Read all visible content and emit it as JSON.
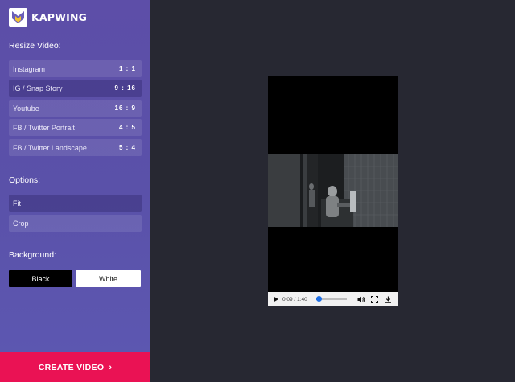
{
  "brand": {
    "name": "KAPWING"
  },
  "resize": {
    "title": "Resize Video:",
    "items": [
      {
        "label": "Instagram",
        "ratio": "1 : 1"
      },
      {
        "label": "IG / Snap Story",
        "ratio": "9 : 16",
        "selected": true
      },
      {
        "label": "Youtube",
        "ratio": "16 : 9"
      },
      {
        "label": "FB / Twitter Portrait",
        "ratio": "4 : 5"
      },
      {
        "label": "FB / Twitter Landscape",
        "ratio": "5 : 4"
      }
    ]
  },
  "options": {
    "title": "Options:",
    "items": [
      {
        "label": "Fit",
        "selected": true
      },
      {
        "label": "Crop"
      }
    ]
  },
  "background": {
    "title": "Background:",
    "black_label": "Black",
    "white_label": "White"
  },
  "create": {
    "label": "CREATE VIDEO"
  },
  "player": {
    "time": "0:09 / 1:40",
    "progress": 0.09
  },
  "colors": {
    "sidebar": "#5a51a9",
    "accent": "#ea1254",
    "workspace": "#272832"
  }
}
